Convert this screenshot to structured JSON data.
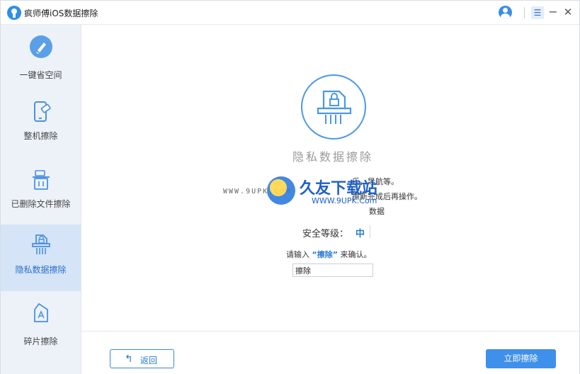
{
  "app": {
    "title": "疯师傅iOS数据擦除"
  },
  "titlebar": {
    "menu_glyph": "☰",
    "minimize_glyph": "−",
    "close_glyph": "✕"
  },
  "sidebar": {
    "items": [
      {
        "label": "一键省空间",
        "icon": "broom-icon",
        "active": false
      },
      {
        "label": "整机擦除",
        "icon": "phone-erase-icon",
        "active": false
      },
      {
        "label": "已删除文件擦除",
        "icon": "trash-icon",
        "active": false
      },
      {
        "label": "隐私数据擦除",
        "icon": "privacy-shred-icon",
        "active": true
      },
      {
        "label": "碎片擦除",
        "icon": "fragment-icon",
        "active": false
      }
    ]
  },
  "main": {
    "title": "隐私数据擦除",
    "desc_lines": [
      "乐，导航等。",
      "擦新完成后再操作。",
      "数据"
    ],
    "security_label": "安全等级：",
    "security_value": "中",
    "confirm_prefix": "请输入",
    "confirm_keyword": "“擦除”",
    "confirm_suffix": "来确认。",
    "input_value": "擦除"
  },
  "watermark": {
    "site": "WWW.9UPK.COM",
    "name": "久友下载站",
    "url": "WWW.9UPK.Com"
  },
  "footer": {
    "back_label": "返回",
    "erase_label": "立即擦除"
  },
  "colors": {
    "accent": "#3e90ea",
    "sidebar_bg": "#edf2f8",
    "sidebar_active": "#d5e4f6"
  }
}
